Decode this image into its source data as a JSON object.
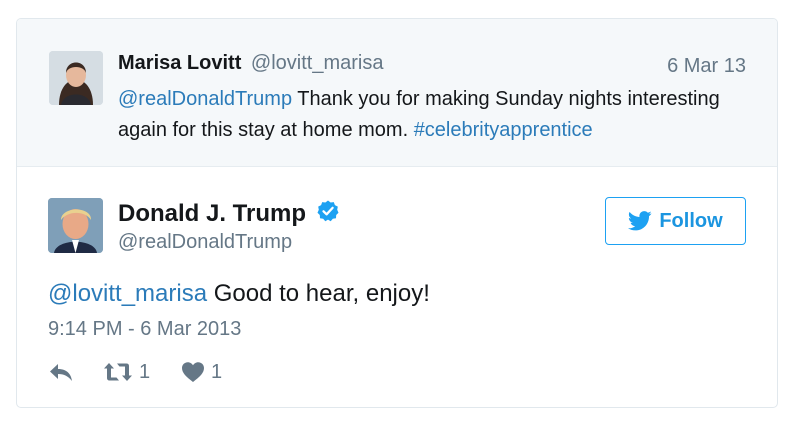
{
  "parent_tweet": {
    "name": "Marisa Lovitt",
    "handle": "@lovitt_marisa",
    "date": "6 Mar 13",
    "mention": "@realDonaldTrump",
    "text": " Thank you for making Sunday nights interesting again for this stay at home mom. ",
    "hashtag": "#celebrityapprentice"
  },
  "main_tweet": {
    "name": "Donald J. Trump",
    "handle": "@realDonaldTrump",
    "verified": true,
    "follow_label": "Follow",
    "mention": "@lovitt_marisa",
    "text": " Good to hear, enjoy!",
    "timestamp": "9:14 PM - 6 Mar 2013",
    "retweet_count": "1",
    "like_count": "1"
  },
  "colors": {
    "link": "#2b7bb9",
    "secondary_text": "#657786",
    "twitter_blue": "#1da1f2",
    "parent_background": "#f5f8fa"
  },
  "icons": [
    "twitter-bird-icon",
    "verified-badge-icon",
    "reply-icon",
    "retweet-icon",
    "heart-icon"
  ]
}
